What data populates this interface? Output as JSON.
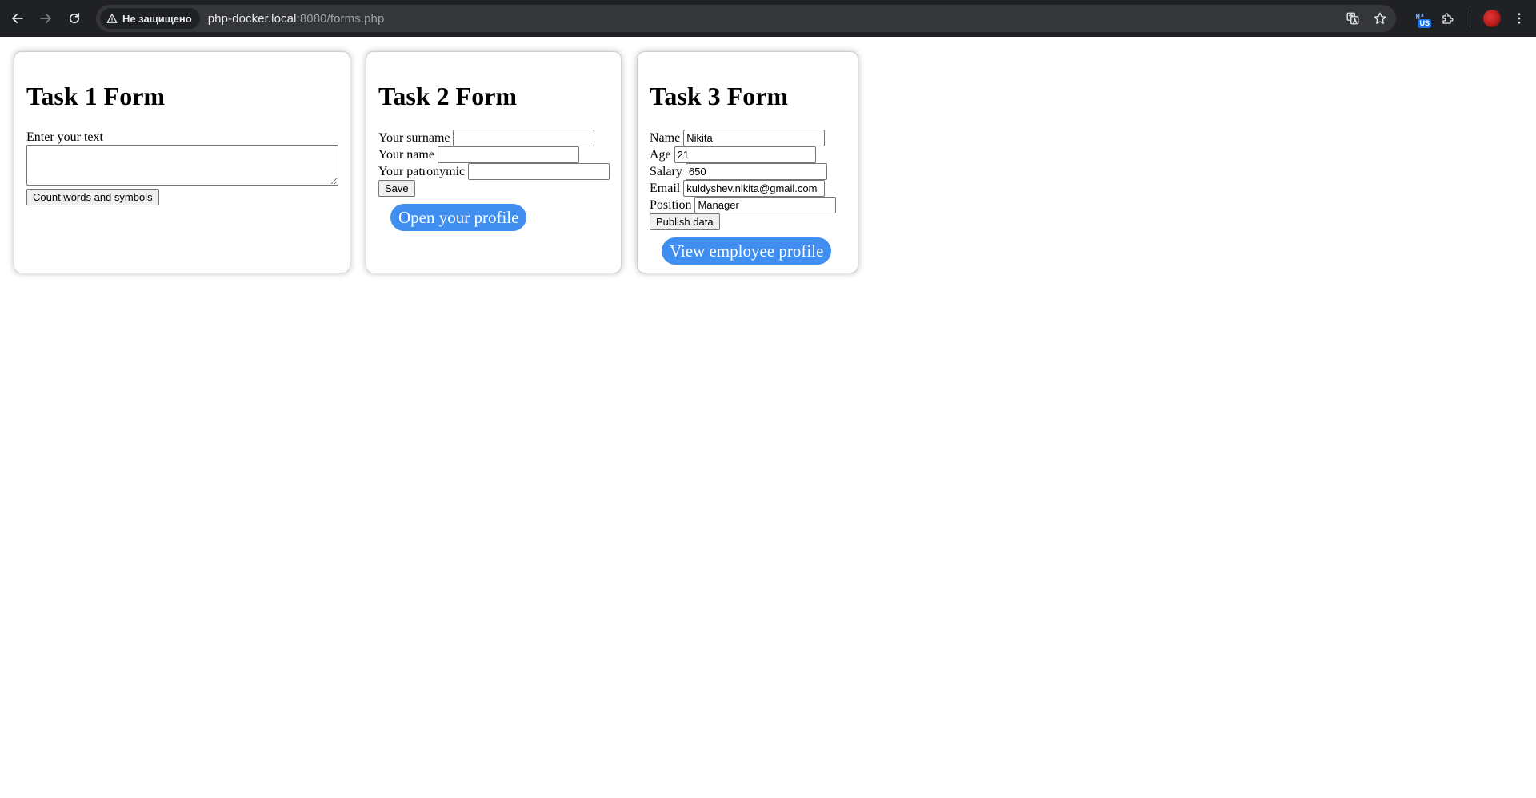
{
  "browser": {
    "security_label": "Не защищено",
    "url_host": "php-docker.local",
    "url_rest": ":8080/forms.php",
    "extension_badge": "US"
  },
  "task1": {
    "title": "Task 1 Form",
    "text_label": "Enter your text",
    "text_value": "",
    "button_label": "Count words and symbols"
  },
  "task2": {
    "title": "Task 2 Form",
    "surname_label": "Your surname",
    "surname_value": "",
    "name_label": "Your name",
    "name_value": "",
    "patronymic_label": "Your patronymic",
    "patronymic_value": "",
    "save_label": "Save",
    "profile_link": "Open your profile"
  },
  "task3": {
    "title": "Task 3 Form",
    "name_label": "Name",
    "name_value": "Nikita",
    "age_label": "Age",
    "age_value": "21",
    "salary_label": "Salary",
    "salary_value": "650",
    "email_label": "Email",
    "email_value": "kuldyshev.nikita@gmail.com",
    "position_label": "Position",
    "position_value": "Manager",
    "publish_label": "Publish data",
    "employee_link": "View employee profile"
  },
  "colors": {
    "chrome_bg": "#202124",
    "omnibox_bg": "#35363a",
    "pill_button": "#3f8ef0"
  },
  "icons": [
    "back-arrow-icon",
    "forward-arrow-icon",
    "reload-icon",
    "warning-triangle-icon",
    "translate-icon",
    "star-icon",
    "extension-icon",
    "puzzle-icon",
    "avatar",
    "kebab-menu-icon"
  ]
}
